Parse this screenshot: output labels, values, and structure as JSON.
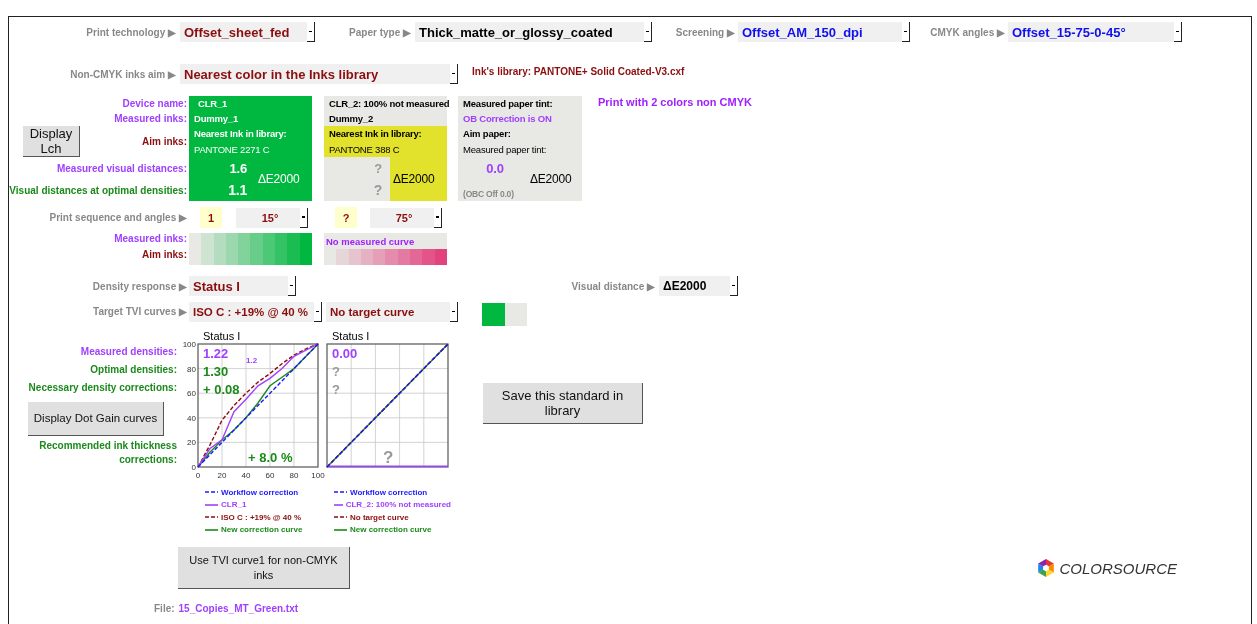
{
  "top_settings": [
    {
      "label": "Print technology ▶",
      "value": "Offset_sheet_fed",
      "color": "#8b0e0e"
    },
    {
      "label": "Paper type ▶",
      "value": "Thick_matte_or_glossy_coated",
      "color": "#000000"
    },
    {
      "label": "Screening ▶",
      "value": "Offset_AM_150_dpi",
      "color": "#1010ee"
    },
    {
      "label": "CMYK angles ▶",
      "value": "Offset_15-75-0-45°",
      "color": "#1010ee"
    }
  ],
  "inks_aim": {
    "label": "Non-CMYK inks aim ▶",
    "value": "Nearest color in the Inks library",
    "library": "Ink's library:  PANTONE+ Solid Coated-V3.cxf"
  },
  "row_labels": {
    "device_name": "Device name:",
    "measured_inks": "Measured inks:",
    "aim_inks": "Aim inks:",
    "measured_distances": "Measured visual distances:",
    "optimal_distances": "Visual distances at optimal densities:"
  },
  "display_lch_button": "Display Lch",
  "inks": [
    {
      "header": "CLR_1",
      "measured_name": "Dummy_1",
      "measured": true,
      "nearest_label": "Nearest Ink in library:",
      "nearest": "PANTONE 2271 C",
      "measured_distance": "1.6",
      "optimal_distance": "1.1",
      "unit": "ΔE2000",
      "color": "#00b83f",
      "aim_ramp": {
        "color": "#00b83f"
      },
      "sequence": "1",
      "angle": "15°"
    },
    {
      "header": "CLR_2: 100% not measured",
      "measured_name": "Dummy_2",
      "measured": false,
      "nearest_label": "Nearest Ink in library:",
      "nearest": "PANTONE 388 C",
      "measured_distance": "?",
      "optimal_distance": "?",
      "unit": "ΔE2000",
      "color": "#e2e22c",
      "measured_ramp_note": "No measured curve",
      "aim_ramp": {
        "color": "#e2437f"
      },
      "sequence": "?",
      "angle": "75°"
    }
  ],
  "paper": {
    "title": "Measured paper tint:",
    "ob_status": "OB Correction is ON",
    "aim_label": "Aim paper:",
    "measured_label": "Measured paper tint:",
    "distance": "0.0",
    "obc_note": "(OBC Off 0.0)",
    "unit": "ΔE2000"
  },
  "print_note": "Print with 2 colors non CMYK",
  "sequence_label": "Print sequence and angles ▶",
  "ramp_labels": {
    "measured": "Measured inks:",
    "aim": "Aim inks:"
  },
  "density": {
    "label": "Density response ▶",
    "value": "Status I"
  },
  "visual_distance": {
    "label": "Visual distance ▶",
    "value": "ΔE2000"
  },
  "tvi": {
    "label": "Target TVI curves ▶",
    "values": [
      "ISO C : +19% @ 40 %",
      "No target curve"
    ],
    "swatches": [
      {
        "color": "#00b83f"
      },
      {
        "color": "#e8e8e4"
      }
    ]
  },
  "chart_labels": {
    "measured": "Measured densities:",
    "optimal": "Optimal densities:",
    "correction": "Necessary density corrections:",
    "thickness": "Recommended ink thickness corrections:"
  },
  "dot_gain_button": "Display Dot Gain curves",
  "charts": [
    {
      "corrections_available": true,
      "overlay": {
        "measured_density": "1.22",
        "measured_density_small": "1.2",
        "optimal_density": "1.30",
        "density_correction": "+ 0.08",
        "thickness_correction": "+ 8.0 %"
      },
      "chart_data": {
        "type": "line",
        "title": "Status I",
        "x": [
          0,
          10,
          20,
          30,
          40,
          50,
          60,
          70,
          80,
          90,
          100
        ],
        "xlim": [
          0,
          100
        ],
        "ylim": [
          0,
          100
        ],
        "xticks": [
          0,
          20,
          40,
          60,
          80,
          100
        ],
        "yticks": [
          0,
          20,
          40,
          60,
          80,
          100
        ],
        "grid": true,
        "series": [
          {
            "name": "Workflow correction",
            "color": "#1a1aff",
            "line_style": "dashed",
            "values": [
              0,
              10,
              20,
              30,
              40,
              50,
              60,
              70,
              80,
              90,
              100
            ]
          },
          {
            "name": "CLR_1",
            "color": "#a040ff",
            "line_style": "solid",
            "values": [
              0,
              15,
              22,
              45,
              55,
              66,
              72,
              80,
              90,
              95,
              100
            ]
          },
          {
            "name": "ISO C : +19% @ 40 %",
            "color": "#8b0e0e",
            "line_style": "dashed",
            "values": [
              0,
              18,
              38,
              50,
              60,
              69,
              76,
              84,
              91,
              96,
              100
            ]
          },
          {
            "name": "New correction curve",
            "color": "#1a8a1a",
            "line_style": "solid",
            "values": [
              0,
              12,
              22,
              30,
              40,
              52,
              66,
              73,
              80,
              90,
              100
            ]
          }
        ]
      }
    },
    {
      "corrections_available": false,
      "title": "Status I",
      "overlay": {
        "measured_density": "0.00",
        "optimal_density": "?",
        "density_correction": "?",
        "thickness_correction": "?"
      },
      "legend": [
        {
          "name": "Workflow correction",
          "color": "#1a1aff",
          "dashed": true,
          "kind": "diagonal"
        },
        {
          "name": "CLR_2: 100% not measured",
          "color": "#a040ff",
          "dashed": false,
          "kind": "baseline"
        },
        {
          "name": "No target curve",
          "color": "#8b0e0e",
          "dashed": true,
          "kind": "diagonal"
        },
        {
          "name": "New correction curve",
          "color": "#1a8a1a",
          "dashed": false,
          "kind": "diagonal"
        }
      ]
    }
  ],
  "save_button": "Save this standard in library",
  "use_tvi_button": "Use TVI curve1 for non-CMYK inks",
  "file": {
    "label": "File:",
    "name": "15_Copies_MT_Green.txt"
  },
  "logo": "COLORSOURCE"
}
